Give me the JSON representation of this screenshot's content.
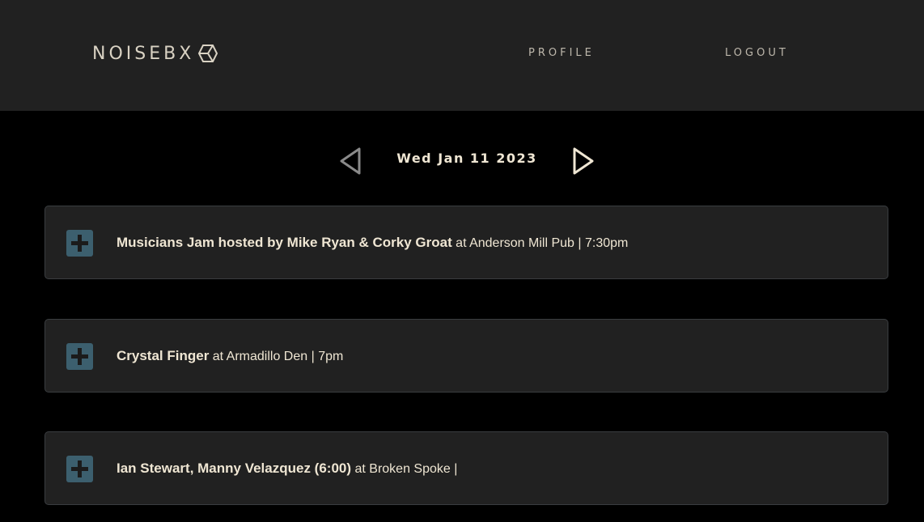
{
  "header": {
    "logo_text": "NOISEBX",
    "logo_icon": "hexagon-cube-icon",
    "nav": {
      "profile_label": "PROFILE",
      "logout_label": "LOGOUT"
    }
  },
  "datebar": {
    "date": "Wed Jan 11 2023",
    "prev_icon": "triangle-left-icon",
    "next_icon": "triangle-right-icon"
  },
  "events": [
    {
      "name": "Musicians Jam hosted by Mike Ryan & Corky Groat",
      "details": " at Anderson Mill Pub | 7:30pm"
    },
    {
      "name": "Crystal Finger",
      "details": " at Armadillo Den | 7pm"
    },
    {
      "name": "Ian Stewart, Manny Velazquez (6:00)",
      "details": " at Broken Spoke |"
    }
  ],
  "colors": {
    "background": "#000000",
    "surface": "#212121",
    "accent_button": "#3c5f6e",
    "text": "#efe6d3"
  }
}
